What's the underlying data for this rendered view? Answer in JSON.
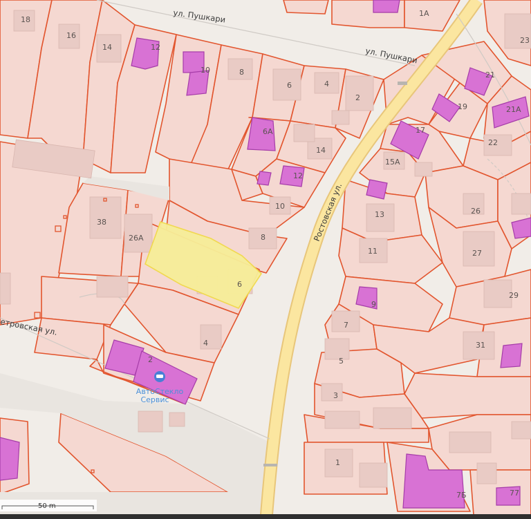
{
  "map": {
    "streets": {
      "pushkari_top": "ул. Пушкари",
      "pushkari_right": "ул. Пушкари",
      "rostovskaya": "Ростовская ул.",
      "petrovskaya": "етровская ул."
    },
    "poi": {
      "line1": "АвтоСтекло",
      "line2": "Сервис"
    },
    "scale_label": "50 m",
    "house_numbers": [
      "18",
      "16",
      "14",
      "12",
      "10",
      "8",
      "6",
      "4",
      "2",
      "1А",
      "23",
      "21",
      "19",
      "21А",
      "22",
      "17",
      "15А",
      "6А",
      "14",
      "12",
      "10",
      "8",
      "6",
      "38",
      "26А",
      "13",
      "26",
      "27",
      "11",
      "29",
      "9",
      "7",
      "5",
      "31",
      "4",
      "2",
      "3",
      "1",
      "7Б",
      "77"
    ],
    "colors": {
      "parcel_fill": "#f5d7d0",
      "parcel_stroke": "#e2552e",
      "building": "#e6c5bf",
      "highlight_building": "#d873d5",
      "selected_parcel": "#f7ef9a",
      "main_road": "#fbe59c"
    }
  }
}
